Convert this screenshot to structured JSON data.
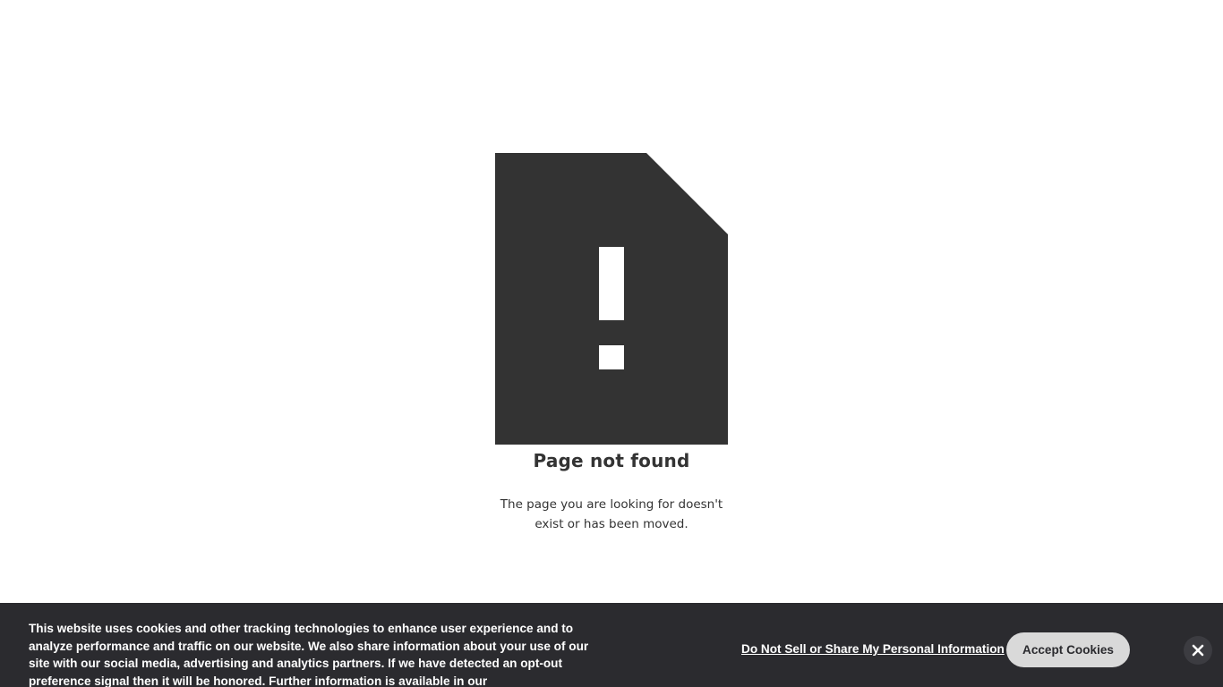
{
  "error": {
    "title": "Page not found",
    "message": "The page you are looking for doesn't exist or has been moved.",
    "illustration_icon": "document-exclamation-icon",
    "illustration_color": "#333333"
  },
  "cookie_banner": {
    "text": "This website uses cookies and other tracking technologies to enhance user experience and to analyze performance and traffic on our website. We also share information about your use of our site with our social media, advertising and analytics partners. If we have detected an opt-out preference signal then it will be honored. Further information is available in our",
    "do_not_sell_label": "Do Not Sell or Share My Personal Information",
    "accept_label": "Accept Cookies",
    "close_icon": "close-icon",
    "background_color": "#2b2b2f",
    "accept_button_color": "#d9d9d9"
  }
}
